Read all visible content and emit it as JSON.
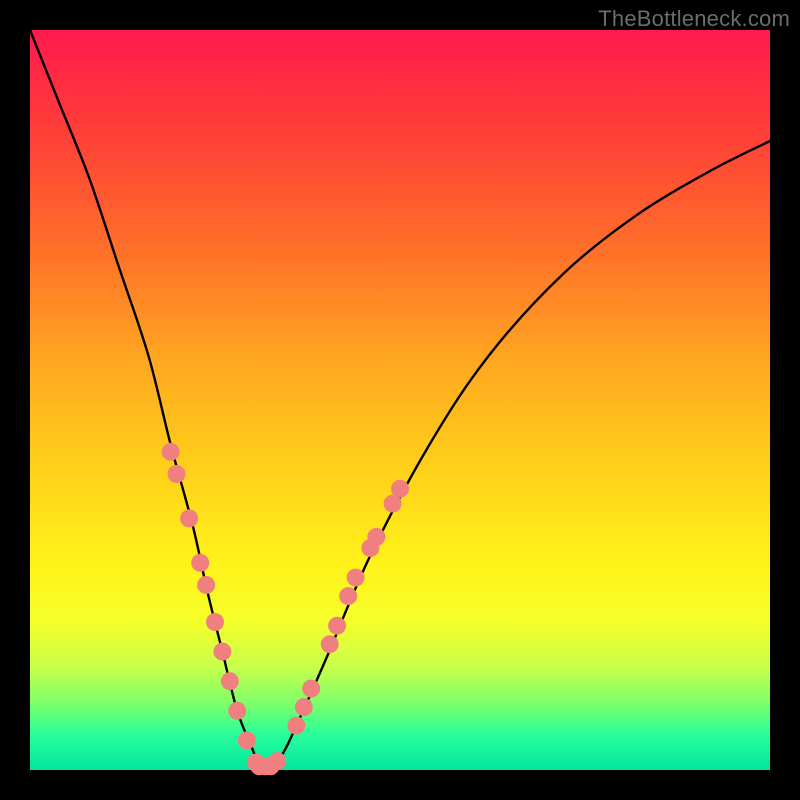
{
  "watermark": {
    "text": "TheBottleneck.com"
  },
  "chart_data": {
    "type": "line",
    "title": "",
    "xlabel": "",
    "ylabel": "",
    "xlim": [
      0,
      100
    ],
    "ylim": [
      0,
      100
    ],
    "grid": false,
    "legend": false,
    "series": [
      {
        "name": "bottleneck-curve",
        "x": [
          0,
          4,
          8,
          12,
          16,
          19,
          22,
          24,
          26,
          28,
          30,
          31,
          32,
          34,
          36,
          40,
          46,
          54,
          62,
          72,
          82,
          92,
          100
        ],
        "y": [
          100,
          90,
          80,
          68,
          56,
          44,
          33,
          24,
          16,
          8,
          3,
          0.5,
          0.5,
          2,
          6,
          15,
          29,
          44,
          56,
          67,
          75,
          81,
          85
        ]
      }
    ],
    "markers": {
      "name": "highlight-dots",
      "color": "#f08080",
      "radius_px": 9,
      "points": [
        {
          "x": 19.0,
          "y": 43
        },
        {
          "x": 19.8,
          "y": 40
        },
        {
          "x": 21.5,
          "y": 34
        },
        {
          "x": 23.0,
          "y": 28
        },
        {
          "x": 23.8,
          "y": 25
        },
        {
          "x": 25.0,
          "y": 20
        },
        {
          "x": 26.0,
          "y": 16
        },
        {
          "x": 27.0,
          "y": 12
        },
        {
          "x": 28.0,
          "y": 8
        },
        {
          "x": 29.3,
          "y": 4
        },
        {
          "x": 30.5,
          "y": 1.0
        },
        {
          "x": 31.0,
          "y": 0.5
        },
        {
          "x": 31.8,
          "y": 0.5
        },
        {
          "x": 32.5,
          "y": 0.5
        },
        {
          "x": 33.4,
          "y": 1.2
        },
        {
          "x": 36.0,
          "y": 6
        },
        {
          "x": 37.0,
          "y": 8.5
        },
        {
          "x": 38.0,
          "y": 11
        },
        {
          "x": 40.5,
          "y": 17
        },
        {
          "x": 41.5,
          "y": 19.5
        },
        {
          "x": 43.0,
          "y": 23.5
        },
        {
          "x": 44.0,
          "y": 26
        },
        {
          "x": 46.0,
          "y": 30
        },
        {
          "x": 46.8,
          "y": 31.5
        },
        {
          "x": 49.0,
          "y": 36
        },
        {
          "x": 50.0,
          "y": 38
        }
      ]
    },
    "background_gradient": {
      "direction": "vertical",
      "stops": [
        {
          "pos": 0.0,
          "color": "#ff1a4d"
        },
        {
          "pos": 0.45,
          "color": "#ffa820"
        },
        {
          "pos": 0.72,
          "color": "#fff21a"
        },
        {
          "pos": 1.0,
          "color": "#00e6a0"
        }
      ]
    }
  }
}
